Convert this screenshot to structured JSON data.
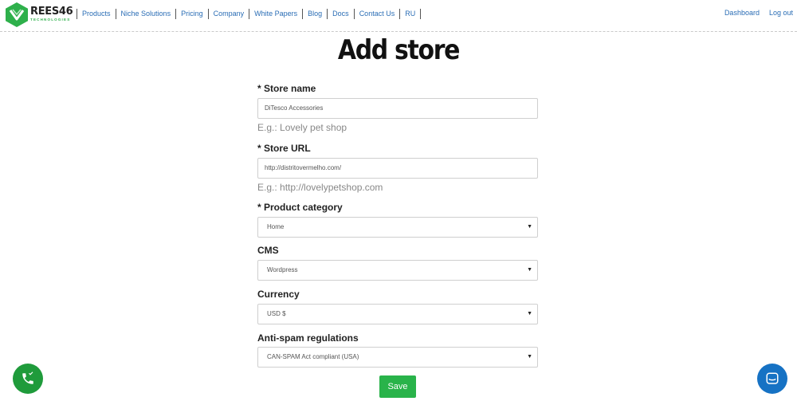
{
  "brand": {
    "name": "REES46",
    "tagline": "TECHNOLOGIES",
    "logo_color": "#2eb04b"
  },
  "nav": {
    "items": [
      "Products",
      "Niche Solutions",
      "Pricing",
      "Company",
      "White Papers",
      "Blog",
      "Docs",
      "Contact Us",
      "RU"
    ],
    "right": {
      "dashboard": "Dashboard",
      "logout": "Log out"
    },
    "link_color": "#2a6db5"
  },
  "page": {
    "title": "Add store"
  },
  "form": {
    "store_name": {
      "label": "* Store name",
      "value": "DiTesco Accessories",
      "hint": "E.g.: Lovely pet shop"
    },
    "store_url": {
      "label": "* Store URL",
      "value": "http://distritovermelho.com/",
      "hint": "E.g.: http://lovelypetshop.com"
    },
    "product_category": {
      "label": "* Product category",
      "value": "Home"
    },
    "cms": {
      "label": "CMS",
      "value": "Wordpress"
    },
    "currency": {
      "label": "Currency",
      "value": "USD $"
    },
    "anti_spam": {
      "label": "Anti-spam regulations",
      "value": "CAN-SPAM Act compliant (USA)"
    },
    "save_label": "Save",
    "save_color": "#29b34a"
  },
  "widgets": {
    "phone_icon": "phone-icon",
    "chat_icon": "chat-icon",
    "phone_color": "#1f9b3b",
    "chat_color": "#1672c4"
  }
}
